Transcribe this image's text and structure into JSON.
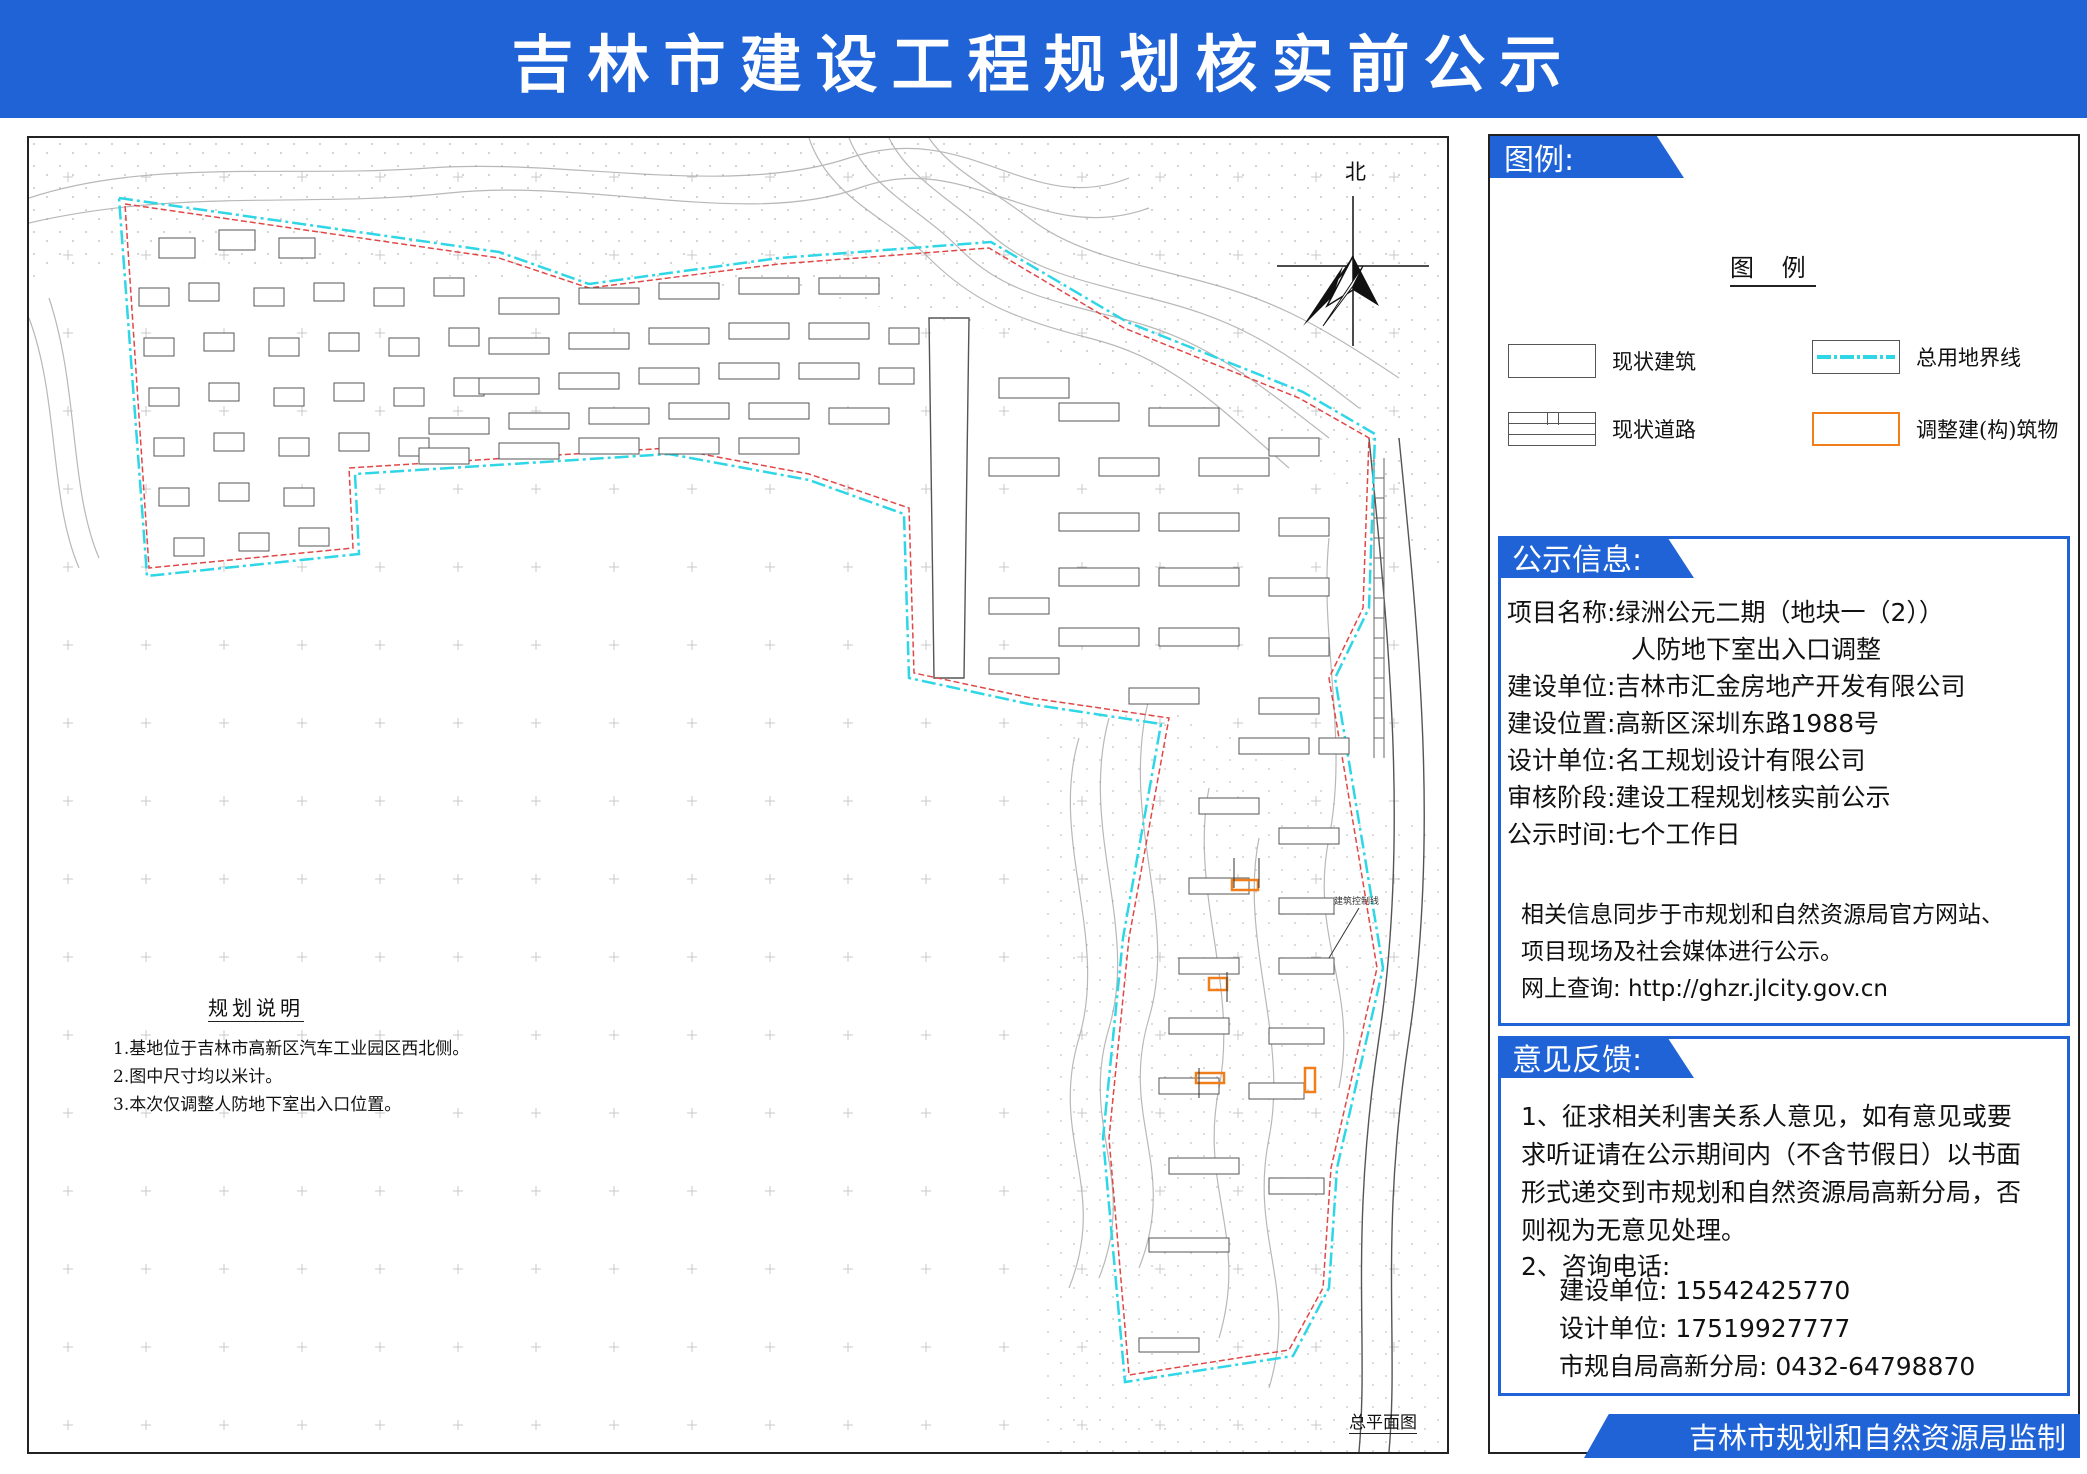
{
  "banner": {
    "title": "吉林市建设工程规划核实前公示"
  },
  "map": {
    "north_label": "北",
    "plan_caption": "总平面图",
    "notes_title": "规划说明",
    "notes": [
      "1.基地位于吉林市高新区汽车工业园区西北侧。",
      "2.图中尺寸均以米计。",
      "3.本次仅调整人防地下室出入口位置。"
    ],
    "boundary_color": "#2fd6e6",
    "road_label": "建筑控制线"
  },
  "legend": {
    "section_title": "图例:",
    "heading": "图 例",
    "items": [
      {
        "label": "现状建筑",
        "icon": "building-swatch"
      },
      {
        "label": "总用地界线",
        "icon": "boundary-line",
        "color": "#2fd6e6"
      },
      {
        "label": "现状道路",
        "icon": "road-swatch"
      },
      {
        "label": "调整建(构)筑物",
        "icon": "adjusted-building",
        "color": "#f07e1a"
      }
    ]
  },
  "info": {
    "section_title": "公示信息:",
    "project_name_label": "项目名称:",
    "project_name_line1": "绿洲公元二期（地块一（2））",
    "project_name_line2": "人防地下室出入口调整",
    "builder_label": "建设单位:",
    "builder": "吉林市汇金房地产开发有限公司",
    "location_label": "建设位置:",
    "location": "高新区深圳东路1988号",
    "designer_label": "设计单位:",
    "designer": "名工规划设计有限公司",
    "stage_label": "审核阶段:",
    "stage": "建设工程规划核实前公示",
    "period_label": "公示时间:",
    "period": "七个工作日",
    "note_line1": "相关信息同步于市规划和自然资源局官方网站、",
    "note_line2": "项目现场及社会媒体进行公示。",
    "note_line3": "网上查询: http://ghzr.jlcity.gov.cn"
  },
  "feedback": {
    "section_title": "意见反馈:",
    "p1_line1": "1、征求相关利害关系人意见，如有意见或要",
    "p1_line2": "求听证请在公示期间内（不含节假日）以书面",
    "p1_line3": "形式递交到市规划和自然资源局高新分局，否",
    "p1_line4": "则视为无意见处理。",
    "p2": "2、咨询电话:",
    "phone1": "建设单位: 15542425770",
    "phone2": "设计单位: 17519927777",
    "phone3": "市规自局高新分局: 0432-64798870"
  },
  "footer": {
    "supervisor": "吉林市规划和自然资源局监制"
  }
}
